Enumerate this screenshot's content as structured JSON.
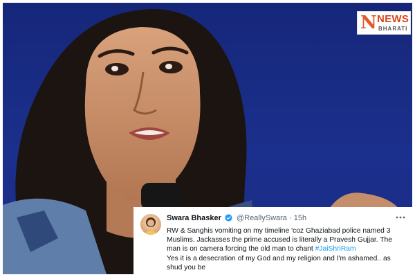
{
  "logo": {
    "brand": "NEWS",
    "sub": "BHARATI",
    "colors": {
      "primary": "#d9441c",
      "mark": "#e3592a"
    }
  },
  "tweet": {
    "display_name": "Swara Bhasker",
    "verified_icon": "verified-badge-icon",
    "handle": "@ReallySwara",
    "separator": "·",
    "time": "15h",
    "more_icon": "more-dots-icon",
    "line1": "RW & Sanghis vomiting on my timeline 'coz Ghaziabad police named 3 Muslims. Jackasses the prime accused is literally a Pravesh Gujjar. The man is on camera forcing the old man to chant ",
    "hashtag": "#JaiShriRam",
    "line2": "Yes it is a desecration of my God and my religion and I'm ashamed.. as shud you be",
    "colors": {
      "link": "#1d9bf0",
      "text": "#0f1419",
      "muted": "#536471"
    }
  },
  "photo": {
    "background_color": "#1b2f8c"
  }
}
